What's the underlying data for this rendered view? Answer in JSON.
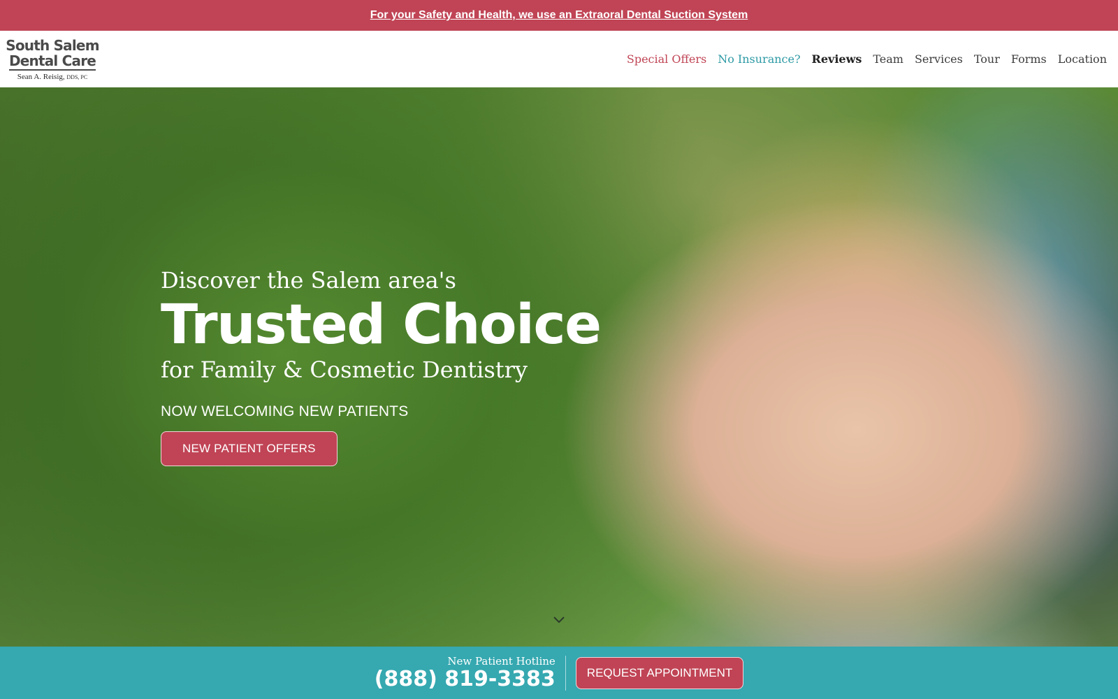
{
  "announcement": {
    "text": "For your Safety and Health, we use an Extraoral Dental Suction System"
  },
  "logo": {
    "line1": "South Salem",
    "line2": "Dental Care",
    "doctor": "Sean A. Reisig,",
    "credentials": "DDS, PC"
  },
  "nav": {
    "items": [
      {
        "label": "Special Offers"
      },
      {
        "label": "No Insurance?"
      },
      {
        "label": "Reviews"
      },
      {
        "label": "Team"
      },
      {
        "label": "Services"
      },
      {
        "label": "Tour"
      },
      {
        "label": "Forms"
      },
      {
        "label": "Location"
      }
    ]
  },
  "hero": {
    "pre_title": "Discover the Salem area's",
    "title": "Trusted Choice",
    "subtitle": "for Family & Cosmetic Dentistry",
    "welcome": "NOW WELCOMING NEW PATIENTS",
    "button_label": "NEW PATIENT OFFERS",
    "scroll_icon": "chevron-down-icon"
  },
  "bottom_bar": {
    "hotline_label": "New Patient Hotline",
    "phone": "(888) 819-3383",
    "button_label": "REQUEST APPOINTMENT"
  },
  "colors": {
    "accent_red": "#c04455",
    "accent_teal": "#35a8b0",
    "nav_teal_text": "#2d9aa5"
  }
}
